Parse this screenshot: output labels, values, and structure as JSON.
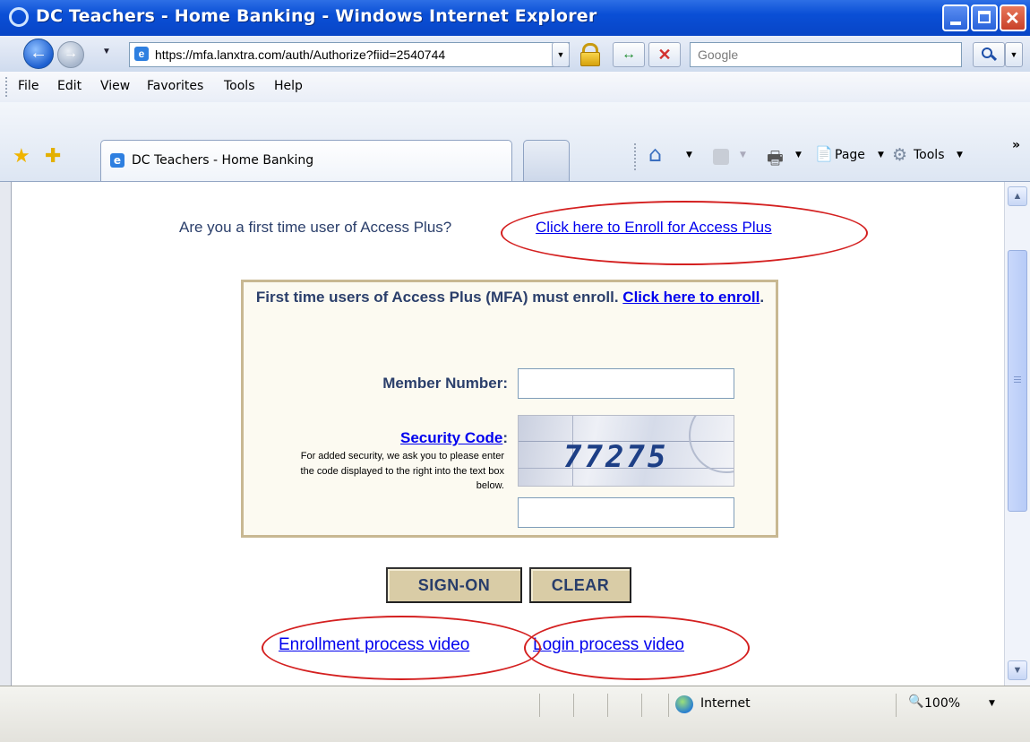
{
  "window": {
    "title": "DC Teachers - Home Banking - Windows Internet Explorer"
  },
  "address": {
    "url": "https://mfa.lanxtra.com/auth/Authorize?fiid=2540744",
    "search_placeholder": "Google"
  },
  "menu": {
    "items": [
      "File",
      "Edit",
      "View",
      "Favorites",
      "Tools",
      "Help"
    ]
  },
  "tabs": {
    "active_label": "DC Teachers - Home Banking"
  },
  "commandbar": {
    "page_label": "Page",
    "tools_label": "Tools"
  },
  "page": {
    "intro_text": "Are you a first time user of Access Plus?",
    "intro_link": "Click here to Enroll for Access Plus",
    "box_heading": "First time users of Access Plus (MFA) must enroll.",
    "box_link": "Click here to enroll",
    "member_label": "Member Number:",
    "security_link": "Security Code",
    "security_colon": ":",
    "security_help": "For added security, we ask you to please enter the code displayed to the right into the text box below.",
    "captcha_code": "77275",
    "signon_label": "SIGN-ON",
    "clear_label": "CLEAR",
    "enroll_video_link": "Enrollment process video",
    "login_video_link": "Login process video"
  },
  "status": {
    "zone": "Internet",
    "zoom": "100%"
  },
  "colors": {
    "titlebar": "#0a4fd6",
    "link": "#0000ee",
    "annotation": "#d42020",
    "button_bg": "#d9cca6",
    "text_navy": "#2b3f6b"
  }
}
